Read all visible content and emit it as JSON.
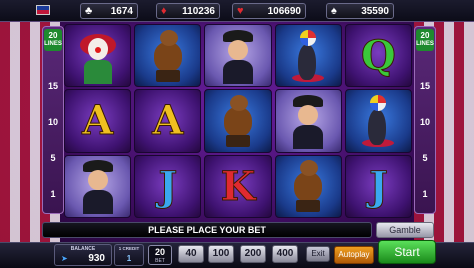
{
  "top": {
    "jackpots": [
      {
        "suit": "club",
        "value": "1674"
      },
      {
        "suit": "diamond",
        "value": "110236"
      },
      {
        "suit": "heart",
        "value": "106690"
      },
      {
        "suit": "spade",
        "value": "35590"
      }
    ]
  },
  "lines": {
    "count": "20",
    "label": "LINES",
    "markers": [
      "15",
      "10",
      "5",
      "1"
    ]
  },
  "reels": [
    [
      "clown",
      "letter-A",
      "dancer"
    ],
    [
      "bear",
      "letter-A",
      "letter-J"
    ],
    [
      "dancer",
      "bear",
      "letter-K"
    ],
    [
      "seal",
      "dancer",
      "bear"
    ],
    [
      "letter-Q",
      "seal",
      "letter-J"
    ]
  ],
  "symbols": {
    "A": "A",
    "J": "J",
    "K": "K",
    "Q": "Q"
  },
  "colors": {
    "A": "#f0c020",
    "J": "#3aa8f0",
    "K": "#e02a30",
    "Q": "#3ac83a"
  },
  "message": "PLEASE PLACE YOUR BET",
  "controls": {
    "gamble": "Gamble",
    "balance_label": "BALANCE",
    "balance": "930",
    "credit_label": "1 CREDIT",
    "credit_value": "1",
    "bet": "20",
    "bet_unit": "BET",
    "bet_options": [
      "40",
      "100",
      "200",
      "400"
    ],
    "exit": "Exit",
    "autoplay": "Autoplay",
    "start": "Start"
  }
}
